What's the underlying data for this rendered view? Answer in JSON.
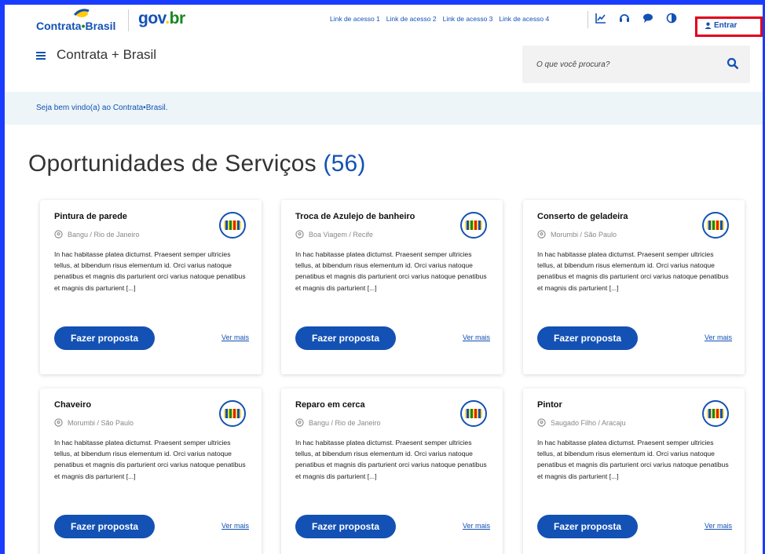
{
  "header": {
    "logo_main": "Contrata",
    "logo_sep": "•",
    "logo_tail": "Brasil",
    "govbr": {
      "part1": "gov",
      "part2": ".",
      "part3": "br"
    },
    "quick_links": [
      "Link de acesso 1",
      "Link de acesso 2",
      "Link de acesso 3",
      "Link de acesso 4"
    ],
    "tools": [
      "chart-icon",
      "headset-icon",
      "chat-icon",
      "contrast-icon"
    ],
    "login_label": "Entrar",
    "site_title": "Contrata + Brasil",
    "search": {
      "placeholder": "O que você procura?"
    }
  },
  "welcome": "Seja bem vindo(a) ao Contrata•Brasil.",
  "page": {
    "title": "Oportunidades de Serviços",
    "count": "(56)"
  },
  "cards": [
    {
      "title": "Pintura de parede",
      "location": "Bangu / Rio de Janeiro",
      "description": "In hac habitasse platea dictumst. Praesent semper ultricies tellus, at bibendum risus elementum id. Orci varius natoque penatibus et magnis dis parturient orci varius natoque penatibus et magnis dis parturient [...]",
      "button": "Fazer proposta",
      "more": "Ver mais"
    },
    {
      "title": "Troca de Azulejo de banheiro",
      "location": "Boa Viagem / Recife",
      "description": "In hac habitasse platea dictumst. Praesent semper ultricies tellus, at bibendum risus elementum id. Orci varius natoque penatibus et magnis dis parturient orci varius natoque penatibus et magnis dis parturient [...]",
      "button": "Fazer proposta",
      "more": "Ver mais"
    },
    {
      "title": "Conserto de geladeira",
      "location": "Morumbi / São Paulo",
      "description": "In hac habitasse platea dictumst. Praesent semper ultricies tellus, at bibendum risus elementum id. Orci varius natoque penatibus et magnis dis parturient orci varius natoque penatibus et magnis dis parturient [...]",
      "button": "Fazer proposta",
      "more": "Ver mais"
    },
    {
      "title": "Chaveiro",
      "location": "Morumbi / São Paulo",
      "description": "In hac habitasse platea dictumst. Praesent semper ultricies tellus, at bibendum risus elementum id. Orci varius natoque penatibus et magnis dis parturient orci varius natoque penatibus et magnis dis parturient [...]",
      "button": "Fazer proposta",
      "more": "Ver mais"
    },
    {
      "title": "Reparo em cerca",
      "location": "Bangu / Rio de Janeiro",
      "description": "In hac habitasse platea dictumst. Praesent semper ultricies tellus, at bibendum risus elementum id. Orci varius natoque penatibus et magnis dis parturient orci varius natoque penatibus et magnis dis parturient [...]",
      "button": "Fazer proposta",
      "more": "Ver mais"
    },
    {
      "title": "Pintor",
      "location": "Saugado Filho / Aracaju",
      "description": "In hac habitasse platea dictumst. Praesent semper ultricies tellus, at bibendum risus elementum id. Orci varius natoque penatibus et magnis dis parturient orci varius natoque penatibus et magnis dis parturient [...]",
      "button": "Fazer proposta",
      "more": "Ver mais"
    }
  ],
  "colors": {
    "primary": "#1351b4",
    "frame": "#1a3cff",
    "highlight": "#e0001b",
    "welcome_bg": "#edf5f8",
    "green": "#168821",
    "yellow": "#ffcd07"
  }
}
